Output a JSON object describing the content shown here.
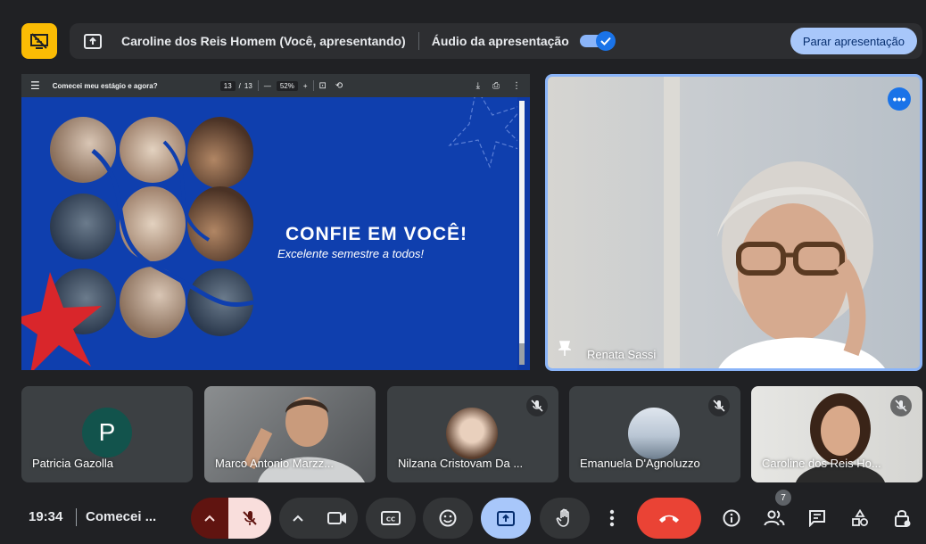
{
  "header": {
    "presenter_label": "Caroline dos Reis Homem (Você, apresentando)",
    "audio_label": "Áudio da apresentação",
    "audio_enabled": true,
    "stop_presenting_label": "Parar apresentação"
  },
  "presentation": {
    "doc_title": "Comecei meu estágio e agora?",
    "page_current": "13",
    "page_separator": "/",
    "page_total": "13",
    "zoom_minus": "—",
    "zoom": "52%",
    "zoom_plus": "+",
    "slide_title": "CONFIE EM VOCÊ!",
    "slide_subtitle": "Excelente semestre a todos!"
  },
  "speaker": {
    "name": "Renata Sassi"
  },
  "participants": [
    {
      "name": "Patricia Gazolla",
      "initial": "P",
      "muted": false,
      "has_video": false
    },
    {
      "name": "Marco Antonio Marzz...",
      "muted": false,
      "has_video": true
    },
    {
      "name": "Nilzana Cristovam Da ...",
      "muted": true,
      "has_video": false
    },
    {
      "name": "Emanuela D'Agnoluzzo",
      "muted": true,
      "has_video": false
    },
    {
      "name": "Caroline dos Reis Ho...",
      "muted": true,
      "has_video": true
    }
  ],
  "footer": {
    "time": "19:34",
    "meeting_name": "Comecei ...",
    "people_count": "7"
  },
  "colors": {
    "accent_blue": "#8ab4f8",
    "present_yellow": "#fbbc04",
    "end_call_red": "#ea4335",
    "slide_blue": "#0f3fae",
    "star_red": "#d9262b"
  }
}
